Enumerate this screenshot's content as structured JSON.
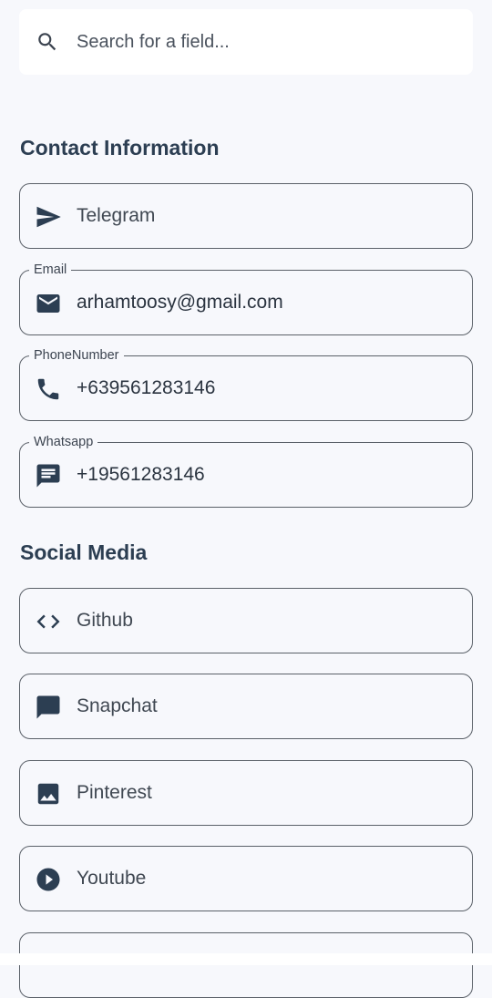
{
  "search": {
    "placeholder": "Search for a field..."
  },
  "sections": {
    "contact": {
      "title": "Contact Information",
      "fields": {
        "telegram": {
          "label": "Telegram",
          "icon": "send-icon"
        },
        "email": {
          "legend": "Email",
          "value": "arhamtoosy@gmail.com",
          "icon": "mail-icon"
        },
        "phone": {
          "legend": "PhoneNumber",
          "value": "+639561283146",
          "icon": "phone-icon"
        },
        "whatsapp": {
          "legend": "Whatsapp",
          "value": "+19561283146",
          "icon": "chat-icon"
        }
      }
    },
    "social": {
      "title": "Social Media",
      "fields": {
        "github": {
          "label": "Github",
          "icon": "code-icon"
        },
        "snapchat": {
          "label": "Snapchat",
          "icon": "message-icon"
        },
        "pinterest": {
          "label": "Pinterest",
          "icon": "image-icon"
        },
        "youtube": {
          "label": "Youtube",
          "icon": "play-circle-icon"
        }
      }
    }
  },
  "colors": {
    "background": "#f7f8fc",
    "icon": "#2c3e52",
    "border": "#5a6068",
    "heading": "#2c3e52"
  }
}
